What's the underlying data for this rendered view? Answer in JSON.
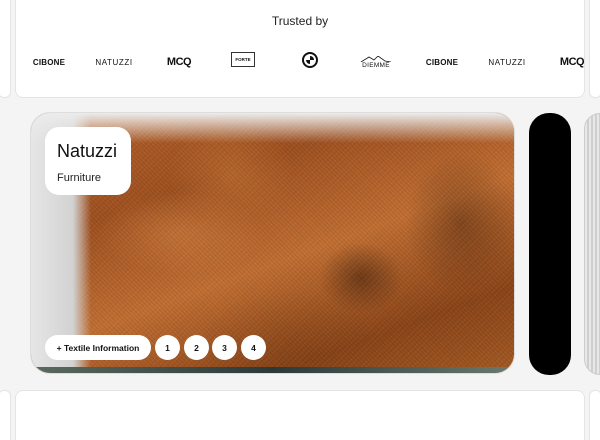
{
  "trusted": {
    "title": "Trusted by",
    "logos": [
      "CIBONE",
      "NATUZZI",
      "MCQ",
      "FORTE",
      "BMW",
      "DIEMME",
      "CIBONE",
      "NATUZZI",
      "MCQ"
    ]
  },
  "card": {
    "name": "Natuzzi",
    "category": "Furniture",
    "info_button": "+ Textile Information",
    "pages": [
      "1",
      "2",
      "3",
      "4"
    ]
  },
  "icons": {
    "bmw": "bmw-logo-icon",
    "forte": "forte-logo-icon"
  }
}
